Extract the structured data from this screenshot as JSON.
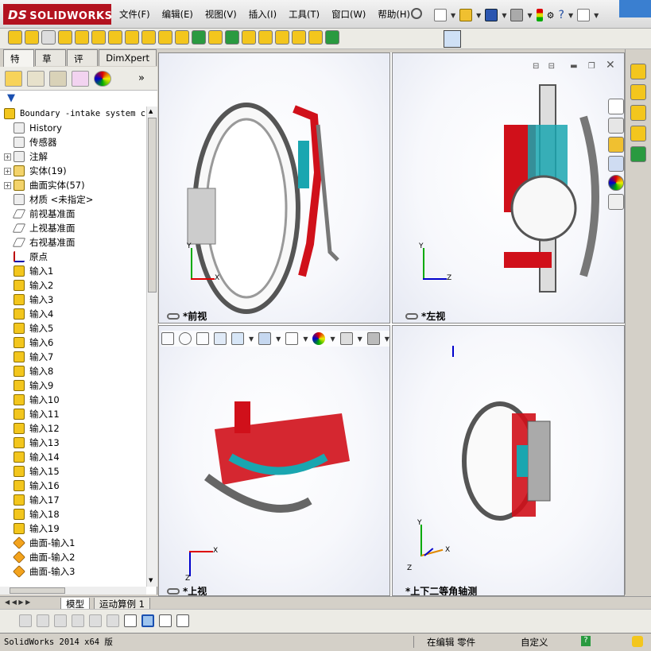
{
  "app": {
    "brand_ds": "DS",
    "brand_name": "SOLIDWORKS"
  },
  "menus": [
    "文件(F)",
    "编辑(E)",
    "视图(V)",
    "插入(I)",
    "工具(T)",
    "窗口(W)",
    "帮助(H)"
  ],
  "tabs": [
    "特征",
    "草图",
    "评估",
    "DimXpert"
  ],
  "tree": {
    "root": "Boundary -intake system ch",
    "items": [
      {
        "label": "History",
        "icon": "history-icon",
        "exp": false
      },
      {
        "label": "传感器",
        "icon": "sensor-icon",
        "exp": false
      },
      {
        "label": "注解",
        "icon": "annotation-icon",
        "exp": true
      },
      {
        "label": "实体(19)",
        "icon": "solid-bodies-folder-icon",
        "exp": true
      },
      {
        "label": "曲面实体(57)",
        "icon": "surface-bodies-folder-icon",
        "exp": true
      },
      {
        "label": "材质 <未指定>",
        "icon": "material-icon",
        "exp": false
      },
      {
        "label": "前视基准面",
        "icon": "plane-icon",
        "exp": false
      },
      {
        "label": "上视基准面",
        "icon": "plane-icon",
        "exp": false
      },
      {
        "label": "右视基准面",
        "icon": "plane-icon",
        "exp": false
      },
      {
        "label": "原点",
        "icon": "origin-icon",
        "exp": false
      },
      {
        "label": "输入1",
        "icon": "import-feature-icon",
        "exp": false
      },
      {
        "label": "输入2",
        "icon": "import-feature-icon",
        "exp": false
      },
      {
        "label": "输入3",
        "icon": "import-feature-icon",
        "exp": false
      },
      {
        "label": "输入4",
        "icon": "import-feature-icon",
        "exp": false
      },
      {
        "label": "输入5",
        "icon": "import-feature-icon",
        "exp": false
      },
      {
        "label": "输入6",
        "icon": "import-feature-icon",
        "exp": false
      },
      {
        "label": "输入7",
        "icon": "import-feature-icon",
        "exp": false
      },
      {
        "label": "输入8",
        "icon": "import-feature-icon",
        "exp": false
      },
      {
        "label": "输入9",
        "icon": "import-feature-icon",
        "exp": false
      },
      {
        "label": "输入10",
        "icon": "import-feature-icon",
        "exp": false
      },
      {
        "label": "输入11",
        "icon": "import-feature-icon",
        "exp": false
      },
      {
        "label": "输入12",
        "icon": "import-feature-icon",
        "exp": false
      },
      {
        "label": "输入13",
        "icon": "import-feature-icon",
        "exp": false
      },
      {
        "label": "输入14",
        "icon": "import-feature-icon",
        "exp": false
      },
      {
        "label": "输入15",
        "icon": "import-feature-icon",
        "exp": false
      },
      {
        "label": "输入16",
        "icon": "import-feature-icon",
        "exp": false
      },
      {
        "label": "输入17",
        "icon": "import-feature-icon",
        "exp": false
      },
      {
        "label": "输入18",
        "icon": "import-feature-icon",
        "exp": false
      },
      {
        "label": "输入19",
        "icon": "import-feature-icon",
        "exp": false
      },
      {
        "label": "曲面-输入1",
        "icon": "surface-import-icon",
        "exp": false
      },
      {
        "label": "曲面-输入2",
        "icon": "surface-import-icon",
        "exp": false
      },
      {
        "label": "曲面-输入3",
        "icon": "surface-import-icon",
        "exp": false
      }
    ]
  },
  "viewports": {
    "front": "*前视",
    "left": "*左视",
    "top": "*上视",
    "iso": "*上下二等角轴测"
  },
  "axes": {
    "x": "X",
    "y": "Y",
    "z": "Z"
  },
  "bottom_tabs": [
    "模型",
    "运动算例 1"
  ],
  "status": {
    "version": "SolidWorks 2014 x64 版",
    "editing": "在编辑 零件",
    "custom": "自定义",
    "help": "?"
  },
  "colors": {
    "red": "#d0101a",
    "cyan": "#1aa6b0",
    "gray": "#8a8a8a"
  }
}
